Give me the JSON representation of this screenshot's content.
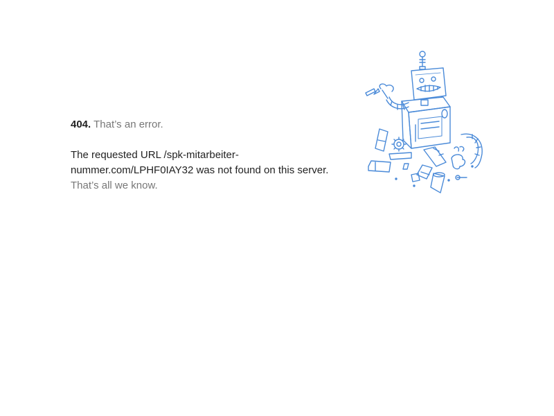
{
  "error": {
    "code": "404.",
    "title": "That’s an error.",
    "message_prefix": "The requested URL ",
    "url": "/spk-mitarbeiter-nummer.com/LPHF0IAY32",
    "message_suffix": " was not found on this server.",
    "footer": "That’s all we know."
  },
  "colors": {
    "text": "#222222",
    "muted": "#777777",
    "illustration": "#4a8ad8"
  },
  "illustration": {
    "icon": "broken-robot-icon"
  }
}
